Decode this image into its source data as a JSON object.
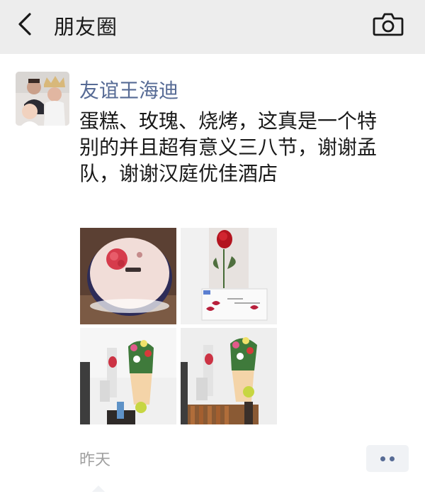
{
  "nav": {
    "title": "朋友圈",
    "back_icon": "chevron-left-icon",
    "camera_icon": "camera-icon"
  },
  "post": {
    "author": "友谊王海迪",
    "text": "蛋糕、玫瑰、烧烤，这真是一个特别的并且超有意义三八节，谢谢孟队，谢谢汉庭优佳酒店",
    "timestamp": "昨天",
    "photos": [
      "cake-photo",
      "rose-photo",
      "bouquet-photo",
      "bouquet-bbq-photo"
    ],
    "more_icon": "more-dots-icon"
  },
  "colors": {
    "nav_bg": "#ededed",
    "name_link": "#576b95",
    "text": "#191919",
    "timestamp": "#a0a0a0"
  }
}
